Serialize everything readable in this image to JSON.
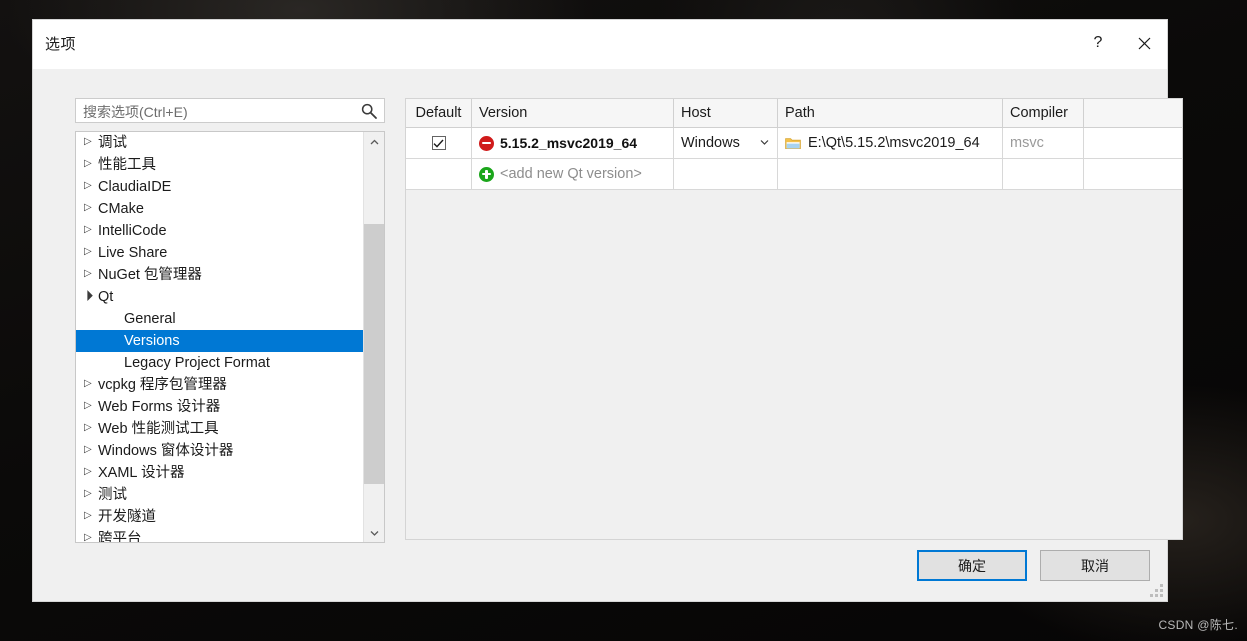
{
  "window": {
    "title": "选项",
    "help_label": "?",
    "close_label": "✕"
  },
  "search": {
    "placeholder": "搜索选项(Ctrl+E)",
    "value": ""
  },
  "tree": {
    "items": [
      {
        "label": "调试",
        "state": "collapsed",
        "level": 0,
        "selected": false
      },
      {
        "label": "性能工具",
        "state": "collapsed",
        "level": 0,
        "selected": false
      },
      {
        "label": "ClaudiaIDE",
        "state": "collapsed",
        "level": 0,
        "selected": false
      },
      {
        "label": "CMake",
        "state": "collapsed",
        "level": 0,
        "selected": false
      },
      {
        "label": "IntelliCode",
        "state": "collapsed",
        "level": 0,
        "selected": false
      },
      {
        "label": "Live Share",
        "state": "collapsed",
        "level": 0,
        "selected": false
      },
      {
        "label": "NuGet 包管理器",
        "state": "collapsed",
        "level": 0,
        "selected": false
      },
      {
        "label": "Qt",
        "state": "expanded",
        "level": 0,
        "selected": false
      },
      {
        "label": "General",
        "state": "none",
        "level": 1,
        "selected": false
      },
      {
        "label": "Versions",
        "state": "none",
        "level": 1,
        "selected": true
      },
      {
        "label": "Legacy Project Format",
        "state": "none",
        "level": 1,
        "selected": false
      },
      {
        "label": "vcpkg 程序包管理器",
        "state": "collapsed",
        "level": 0,
        "selected": false
      },
      {
        "label": "Web Forms 设计器",
        "state": "collapsed",
        "level": 0,
        "selected": false
      },
      {
        "label": "Web 性能测试工具",
        "state": "collapsed",
        "level": 0,
        "selected": false
      },
      {
        "label": "Windows 窗体设计器",
        "state": "collapsed",
        "level": 0,
        "selected": false
      },
      {
        "label": "XAML 设计器",
        "state": "collapsed",
        "level": 0,
        "selected": false
      },
      {
        "label": "测试",
        "state": "collapsed",
        "level": 0,
        "selected": false
      },
      {
        "label": "开发隧道",
        "state": "collapsed",
        "level": 0,
        "selected": false
      },
      {
        "label": "跨平台",
        "state": "collapsed",
        "level": 0,
        "selected": false
      }
    ]
  },
  "grid": {
    "columns": [
      "Default",
      "Version",
      "Host",
      "Path",
      "Compiler",
      ""
    ],
    "rows": [
      {
        "default_checked": true,
        "version": "5.15.2_msvc2019_64",
        "version_icon": "deny-icon",
        "host": "Windows",
        "path": "E:\\Qt\\5.15.2\\msvc2019_64",
        "path_icon": "folder-icon",
        "compiler": "msvc",
        "extra": ""
      },
      {
        "default_checked": false,
        "version": "<add new Qt version>",
        "version_icon": "plus-icon",
        "host": "",
        "path": "",
        "path_icon": "",
        "compiler": "",
        "extra": ""
      }
    ]
  },
  "footer": {
    "ok_label": "确定",
    "cancel_label": "取消"
  },
  "watermark": {
    "text": "CSDN @陈七."
  },
  "colors": {
    "accent": "#0078d4",
    "selection": "#0078d4",
    "deny": "#d01a1a",
    "plus": "#1ba61b",
    "folder": "#f5c044",
    "dialog_bg": "#f0f0f0"
  }
}
